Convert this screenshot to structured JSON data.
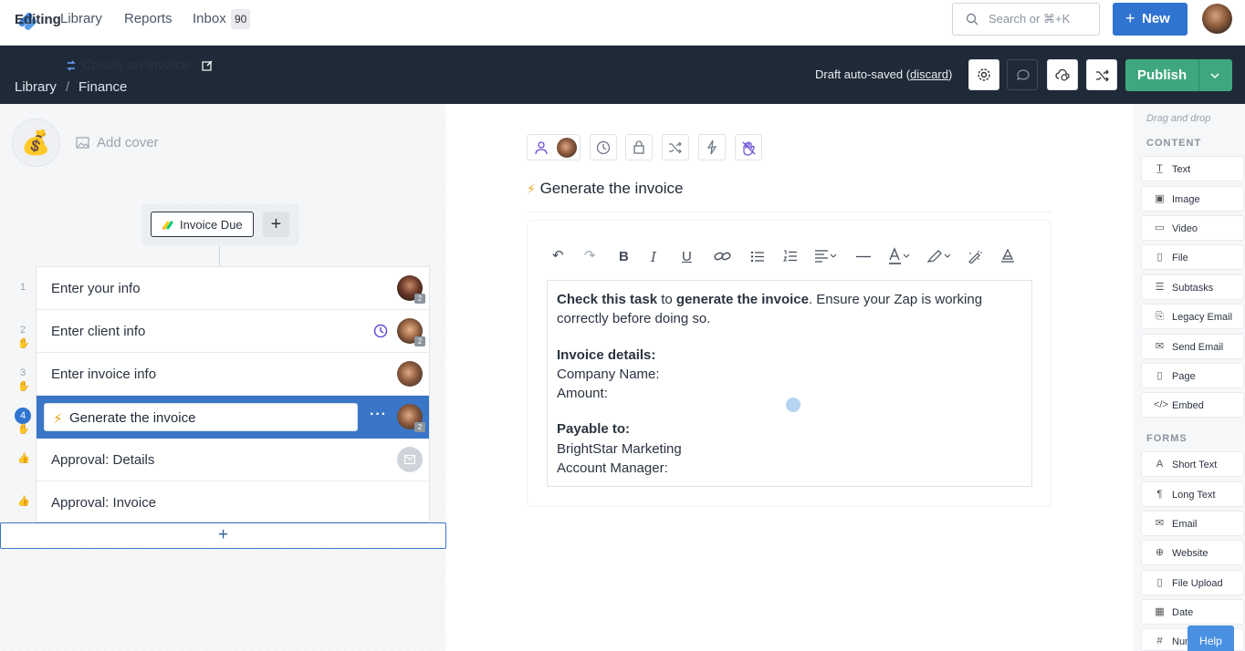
{
  "nav": {
    "links": [
      "Library",
      "Reports",
      "Inbox"
    ],
    "inbox_count": "90",
    "search_placeholder": "Search or ⌘+K",
    "new_label": "New"
  },
  "editbar": {
    "mode": "Editing",
    "title": "Create an Invoice",
    "breadcrumb": [
      "Library",
      "Finance"
    ],
    "draft_text": "Draft auto-saved (",
    "discard": "discard",
    "draft_close": ")",
    "publish": "Publish"
  },
  "left": {
    "add_cover": "Add cover",
    "trigger": "Invoice Due",
    "tasks": [
      {
        "num": "1",
        "name": "Enter your info",
        "badge": "2"
      },
      {
        "num": "2",
        "name": "Enter client info",
        "badge": "2"
      },
      {
        "num": "3",
        "name": "Enter invoice info",
        "badge": ""
      },
      {
        "num": "4",
        "name": "Generate the invoice",
        "badge": "2"
      },
      {
        "num": "",
        "name": "Approval: Details",
        "badge": ""
      },
      {
        "num": "",
        "name": "Approval: Invoice",
        "badge": ""
      }
    ]
  },
  "editor": {
    "task_title": "Generate the invoice",
    "p1_b1": "Check this task",
    "p1_t1": " to ",
    "p1_b2": "generate the invoice",
    "p1_t2": ". Ensure your Zap is working correctly before doing so.",
    "details_heading": "Invoice details:",
    "company": "Company Name:",
    "amount": "Amount:",
    "payable_heading": "Payable to:",
    "payee": "BrightStar Marketing",
    "manager": "Account Manager:"
  },
  "palette": {
    "hint": "Drag and drop",
    "content_heading": "CONTENT",
    "content": [
      "Text",
      "Image",
      "Video",
      "File",
      "Subtasks",
      "Legacy Email",
      "Send Email",
      "Page",
      "Embed"
    ],
    "forms_heading": "FORMS",
    "forms": [
      "Short Text",
      "Long Text",
      "Email",
      "Website",
      "File Upload",
      "Date",
      "Number"
    ],
    "help": "Help"
  },
  "colors": {
    "brand": "#2f74d0",
    "editbar": "#1f2a38",
    "publish": "#3fa77f",
    "active_task": "#3a76c7"
  }
}
